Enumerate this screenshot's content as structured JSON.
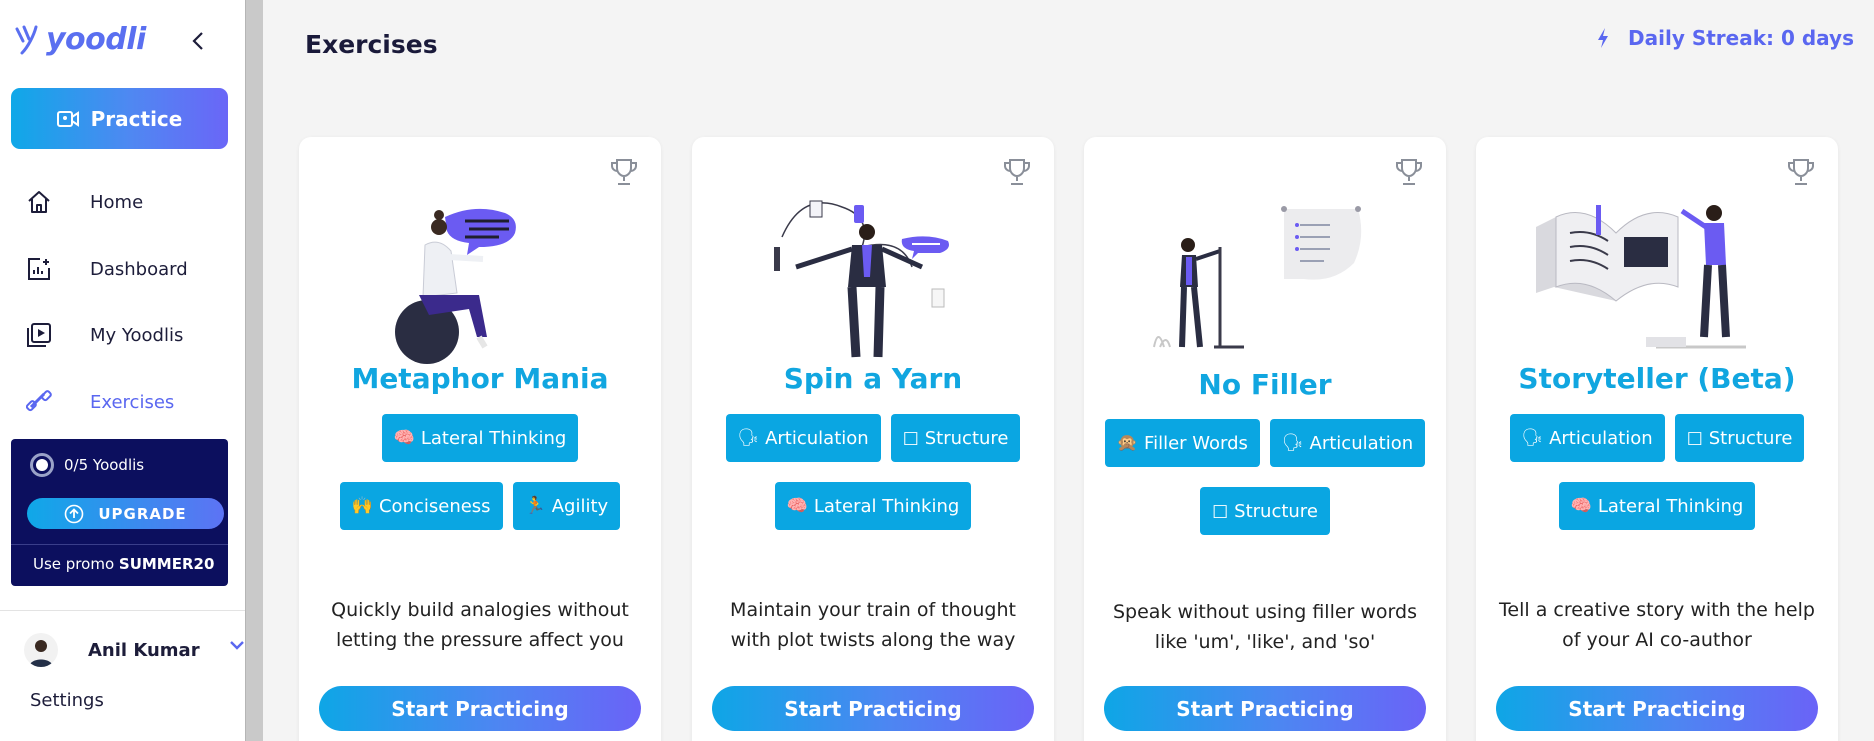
{
  "sidebar": {
    "logo_text": "yoodli",
    "practice_label": "Practice",
    "nav": [
      {
        "label": "Home",
        "icon": "home-icon"
      },
      {
        "label": "Dashboard",
        "icon": "dashboard-icon"
      },
      {
        "label": "My Yoodlis",
        "icon": "video-library-icon"
      },
      {
        "label": "Exercises",
        "icon": "dumbbell-icon",
        "active": true
      }
    ],
    "promo": {
      "progress": "0/5 Yoodlis",
      "upgrade_label": "UPGRADE",
      "promo_prefix": "Use promo ",
      "promo_code": "SUMMER20"
    },
    "user": {
      "name": "Anil Kumar"
    },
    "settings_label": "Settings"
  },
  "header": {
    "title": "Exercises",
    "streak": "Daily Streak: 0 days"
  },
  "colors": {
    "accent": "#5a67f0",
    "card_title": "#11a6e0",
    "tag_bg": "#0aa6e2",
    "promo_bg": "#0c0f5e"
  },
  "cards": [
    {
      "title": "Metaphor Mania",
      "tags": [
        {
          "emoji": "🧠",
          "label": "Lateral Thinking"
        },
        {
          "emoji": "🙌",
          "label": "Conciseness"
        },
        {
          "emoji": "🏃",
          "label": "Agility"
        }
      ],
      "description": "Quickly build analogies without letting the pressure affect you",
      "button": "Start Practicing"
    },
    {
      "title": "Spin a Yarn",
      "tags": [
        {
          "emoji": "🗣",
          "label": "Articulation"
        },
        {
          "emoji": "□",
          "label": "Structure"
        },
        {
          "emoji": "🧠",
          "label": "Lateral Thinking"
        }
      ],
      "description": "Maintain your train of thought with plot twists along the way",
      "button": "Start Practicing"
    },
    {
      "title": "No Filler",
      "tags": [
        {
          "emoji": "🙊",
          "label": "Filler Words"
        },
        {
          "emoji": "🗣",
          "label": "Articulation"
        },
        {
          "emoji": "□",
          "label": "Structure"
        }
      ],
      "description": "Speak without using filler words like 'um', 'like', and 'so'",
      "button": "Start Practicing"
    },
    {
      "title": "Storyteller (Beta)",
      "tags": [
        {
          "emoji": "🗣",
          "label": "Articulation"
        },
        {
          "emoji": "□",
          "label": "Structure"
        },
        {
          "emoji": "🧠",
          "label": "Lateral Thinking"
        }
      ],
      "description": "Tell a creative story with the help of your AI co-author",
      "button": "Start Practicing"
    }
  ]
}
